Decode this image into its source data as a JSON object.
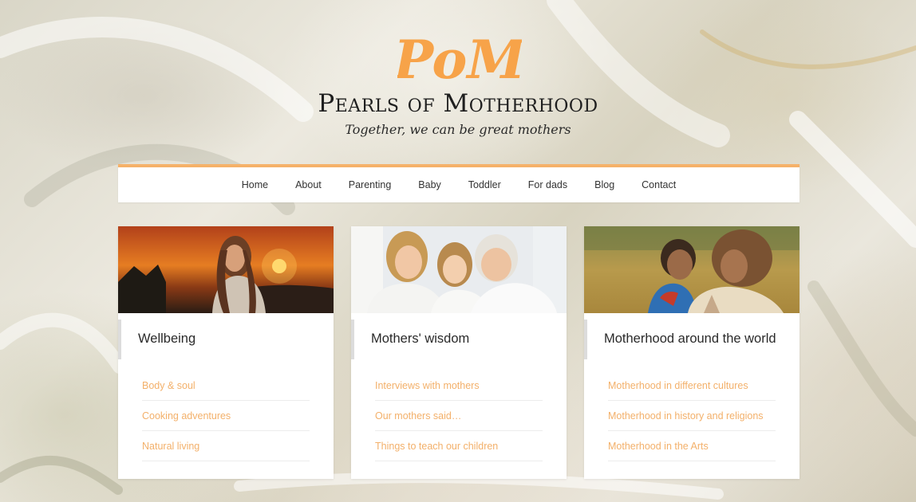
{
  "header": {
    "logo_letters": "PoM",
    "title": "Pearls of Motherhood",
    "tagline": "Together, we can be great mothers"
  },
  "nav": {
    "items": [
      "Home",
      "About",
      "Parenting",
      "Baby",
      "Toddler",
      "For dads",
      "Blog",
      "Contact"
    ]
  },
  "cards": [
    {
      "title": "Wellbeing",
      "image": "woman-at-sunset-photo",
      "links": [
        "Body & soul",
        "Cooking adventures",
        "Natural living"
      ]
    },
    {
      "title": "Mothers' wisdom",
      "image": "three-generations-photo",
      "links": [
        "Interviews with mothers",
        "Our mothers said…",
        "Things to teach our children"
      ]
    },
    {
      "title": "Motherhood around the world",
      "image": "mother-and-child-photo",
      "links": [
        "Motherhood in different cultures",
        "Motherhood in history and religions",
        "Motherhood in the Arts"
      ]
    }
  ],
  "colors": {
    "accent": "#f5b169",
    "link": "#f3b06a",
    "logo": "#f7a349"
  }
}
